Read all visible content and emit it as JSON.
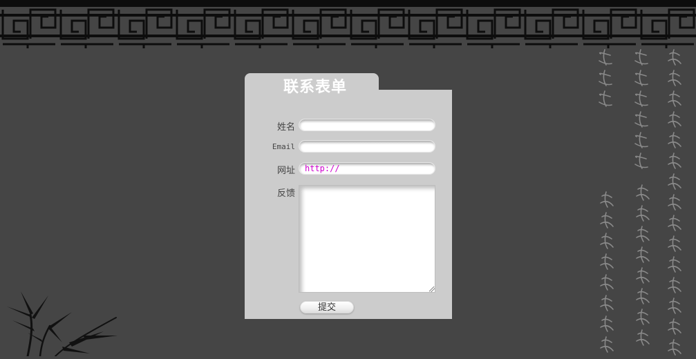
{
  "colors": {
    "background": "#454545",
    "panel": "#cccccc",
    "title_text": "#ffffff",
    "url_text": "#d000d0"
  },
  "form": {
    "title": "联系表单",
    "name_label": "姓名",
    "email_label": "Email",
    "url_label": "网址",
    "url_value": "http://",
    "feedback_label": "反馈",
    "submit_label": "提交"
  },
  "decor": {
    "top_border_icon": "chinese-lattice-pattern",
    "poem_icon": "calligraphy-poem",
    "bamboo_icon": "ink-bamboo"
  }
}
